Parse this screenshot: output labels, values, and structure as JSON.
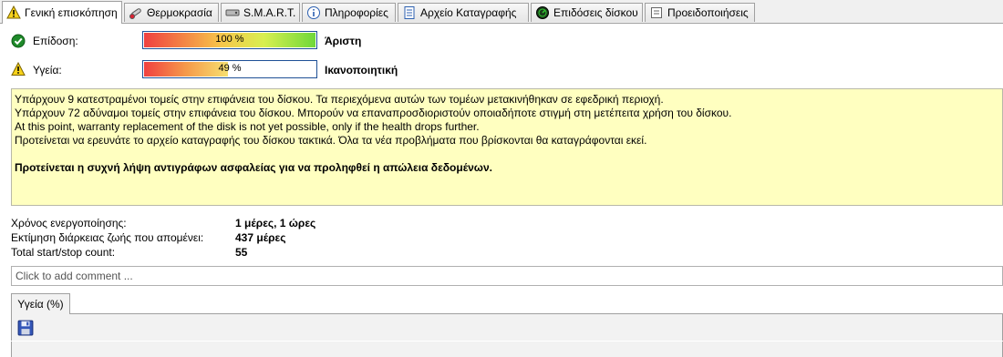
{
  "tabs": [
    {
      "label": "Γενική επισκόπηση",
      "icon": "warning-icon",
      "active": true
    },
    {
      "label": "Θερμοκρασία",
      "icon": "thermometer-icon",
      "active": false
    },
    {
      "label": "S.M.A.R.T.",
      "icon": "smart-icon",
      "active": false
    },
    {
      "label": "Πληροφορίες",
      "icon": "info-icon",
      "active": false
    },
    {
      "label": "Αρχείο Καταγραφής",
      "icon": "log-icon",
      "active": false
    },
    {
      "label": "Επιδόσεις δίσκου",
      "icon": "performance-icon",
      "active": false
    },
    {
      "label": "Προειδοποιήσεις",
      "icon": "alerts-icon",
      "active": false
    }
  ],
  "performance": {
    "label": "Επίδοση:",
    "icon": "check-icon",
    "percent_text": "100 %",
    "percent": 100,
    "verdict": "Άριστη"
  },
  "health": {
    "label": "Υγεία:",
    "icon": "warning-icon",
    "percent_text": "49 %",
    "percent": 49,
    "verdict": "Ικανοποιητική"
  },
  "message": {
    "lines": [
      "Υπάρχουν 9 κατεστραμένοι τομείς στην επιφάνεια του δίσκου. Τα περιεχόμενα αυτών των τομέων μετακινήθηκαν σε εφεδρική περιοχή.",
      "Υπάρχουν 72 αδύναμοι τομείς στην επιφάνεια του δίσκου. Μπορούν να επαναπροσδιοριστούν οποιαδήποτε στιγμή στη μετέπειτα χρήση του δίσκου.",
      "At this point, warranty replacement of the disk is not yet possible, only if the health drops further.",
      "Προτείνεται να ερευνάτε το αρχείο καταγραφής του δίσκου τακτικά. Όλα τα νέα προβλήματα που βρίσκονται θα καταγράφονται εκεί."
    ],
    "recommendation": "Προτείνεται η συχνή λήψη αντιγράφων ασφαλείας για να προληφθεί η απώλεια δεδομένων."
  },
  "stats": [
    {
      "label": "Χρόνος ενεργοποίησης:",
      "value": "1 μέρες, 1 ώρες"
    },
    {
      "label": "Εκτίμηση διάρκειας ζωής που απομένει:",
      "value": "437 μέρες"
    },
    {
      "label": "Total start/stop count:",
      "value": "55"
    }
  ],
  "comment": {
    "placeholder": "Click to add comment ..."
  },
  "bottom_tabs": [
    {
      "label": "Υγεία (%)"
    }
  ],
  "colors": {
    "bar_border": "#1e4f96",
    "message_bg": "#ffffc0"
  }
}
